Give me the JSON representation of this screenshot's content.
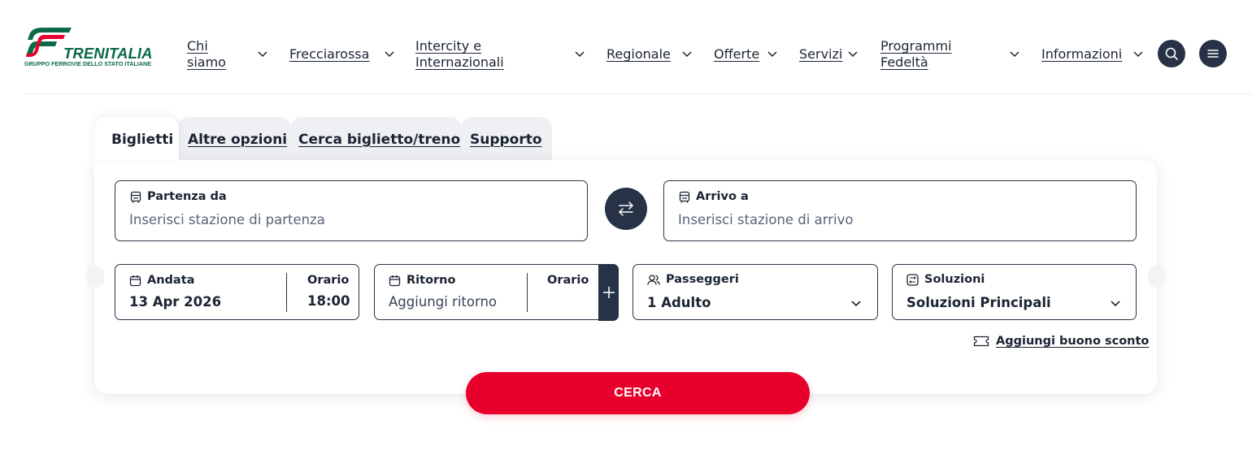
{
  "brand": {
    "name": "TRENITALIA",
    "tagline": "GRUPPO FERROVIE DELLO STATO ITALIANE",
    "color": "#0b6a45",
    "accent": "#e8002d"
  },
  "nav": {
    "items": [
      {
        "label": "Chi siamo",
        "lines": [
          "Chi",
          "siamo"
        ]
      },
      {
        "label": "Frecciarossa",
        "lines": [
          "Frecciarossa"
        ]
      },
      {
        "label": "Intercity e Internazionali",
        "lines": [
          "Intercity e",
          "Internazionali"
        ]
      },
      {
        "label": "Regionale",
        "lines": [
          "Regionale"
        ]
      },
      {
        "label": "Offerte",
        "lines": [
          "Offerte"
        ]
      },
      {
        "label": "Servizi",
        "lines": [
          "Servizi"
        ]
      },
      {
        "label": "Programmi Fedeltà",
        "lines": [
          "Programmi",
          "Fedeltà"
        ]
      },
      {
        "label": "Informazioni",
        "lines": [
          "Informazioni"
        ]
      }
    ],
    "search_icon": "search-icon",
    "menu_icon": "hamburger-menu-icon"
  },
  "tabs": [
    {
      "label": "Biglietti",
      "active": true
    },
    {
      "label": "Altre opzioni",
      "active": false
    },
    {
      "label": "Cerca biglietto/treno",
      "active": false
    },
    {
      "label": "Supporto",
      "active": false
    }
  ],
  "form": {
    "departure": {
      "label": "Partenza da",
      "placeholder": "Inserisci stazione di partenza",
      "icon": "station-icon"
    },
    "arrival": {
      "label": "Arrivo a",
      "placeholder": "Inserisci stazione di arrivo",
      "icon": "station-icon"
    },
    "swap_icon": "swap-arrows-icon",
    "outbound": {
      "label": "Andata",
      "value": "13 Apr 2026",
      "time_label": "Orario",
      "time_value": "18:00",
      "icon": "calendar-icon"
    },
    "return": {
      "label": "Ritorno",
      "placeholder": "Aggiungi ritorno",
      "time_label": "Orario",
      "icon": "calendar-icon",
      "add_icon": "plus-icon"
    },
    "passengers": {
      "label": "Passeggeri",
      "value": "1 Adulto",
      "icon": "users-icon"
    },
    "solutions": {
      "label": "Soluzioni",
      "value": "Soluzioni Principali",
      "icon": "filter-icon"
    },
    "discount_label": "Aggiungi buono sconto",
    "discount_icon": "ticket-icon",
    "search_label": "CERCA"
  }
}
